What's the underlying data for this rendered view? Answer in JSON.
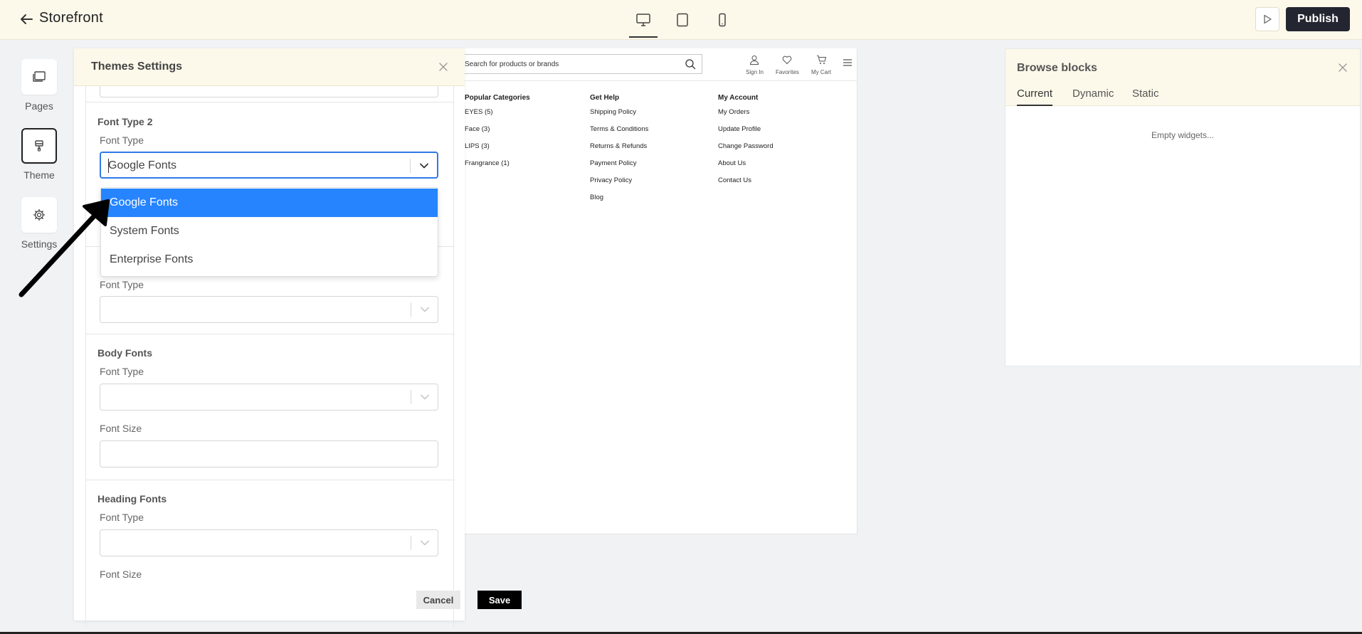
{
  "app": {
    "title": "Storefront"
  },
  "header": {
    "publish_label": "Publish"
  },
  "nav": {
    "items": [
      {
        "label": "Pages",
        "icon": "pages-icon"
      },
      {
        "label": "Theme",
        "icon": "paint-brush-icon",
        "active": true
      },
      {
        "label": "Settings",
        "icon": "gear-icon"
      }
    ]
  },
  "theme_settings": {
    "title": "Themes Settings",
    "sections": [
      {
        "title": "Font Type 2",
        "field_label": "Font Type",
        "value": "Google Fonts",
        "placeholder": ""
      },
      {
        "title": "",
        "field_label": "Font Type",
        "value": ""
      },
      {
        "title": "Body Fonts",
        "type_label": "Font Type",
        "size_label": "Font Size"
      },
      {
        "title": "Heading Fonts",
        "type_label": "Font Type",
        "size_label": "Font Size"
      }
    ],
    "dropdown_options": [
      "Google Fonts",
      "System Fonts",
      "Enterprise Fonts"
    ],
    "selected_option": "Google Fonts",
    "cancel_label": "Cancel",
    "save_label": "Save"
  },
  "preview": {
    "search_placeholder": "Search for products or brands",
    "icons": [
      {
        "label": "Sign In",
        "icon": "user-icon"
      },
      {
        "label": "Favorites",
        "icon": "heart-icon"
      },
      {
        "label": "My Cart",
        "icon": "cart-icon"
      }
    ],
    "columns": [
      {
        "title": "Popular Categories",
        "links": [
          "EYES (5)",
          "Face (3)",
          "LIPS (3)",
          "Frangrance (1)"
        ]
      },
      {
        "title": "Get Help",
        "links": [
          "Shipping Policy",
          "Terms & Conditions",
          "Returns & Refunds",
          "Payment Policy",
          "Privacy Policy",
          "Blog"
        ]
      },
      {
        "title": "My Account",
        "links": [
          "My Orders",
          "Update Profile",
          "Change Password",
          "About Us",
          "Contact Us"
        ]
      }
    ]
  },
  "browse_blocks": {
    "title": "Browse blocks",
    "tabs": [
      "Current",
      "Dynamic",
      "Static"
    ],
    "active_tab": "Current",
    "empty_text": "Empty widgets..."
  },
  "colors": {
    "header_bg": "#fcf8ea",
    "publish_bg": "#232630",
    "selected_option_bg": "#2684ff",
    "focus_border": "#2f7ae5"
  }
}
